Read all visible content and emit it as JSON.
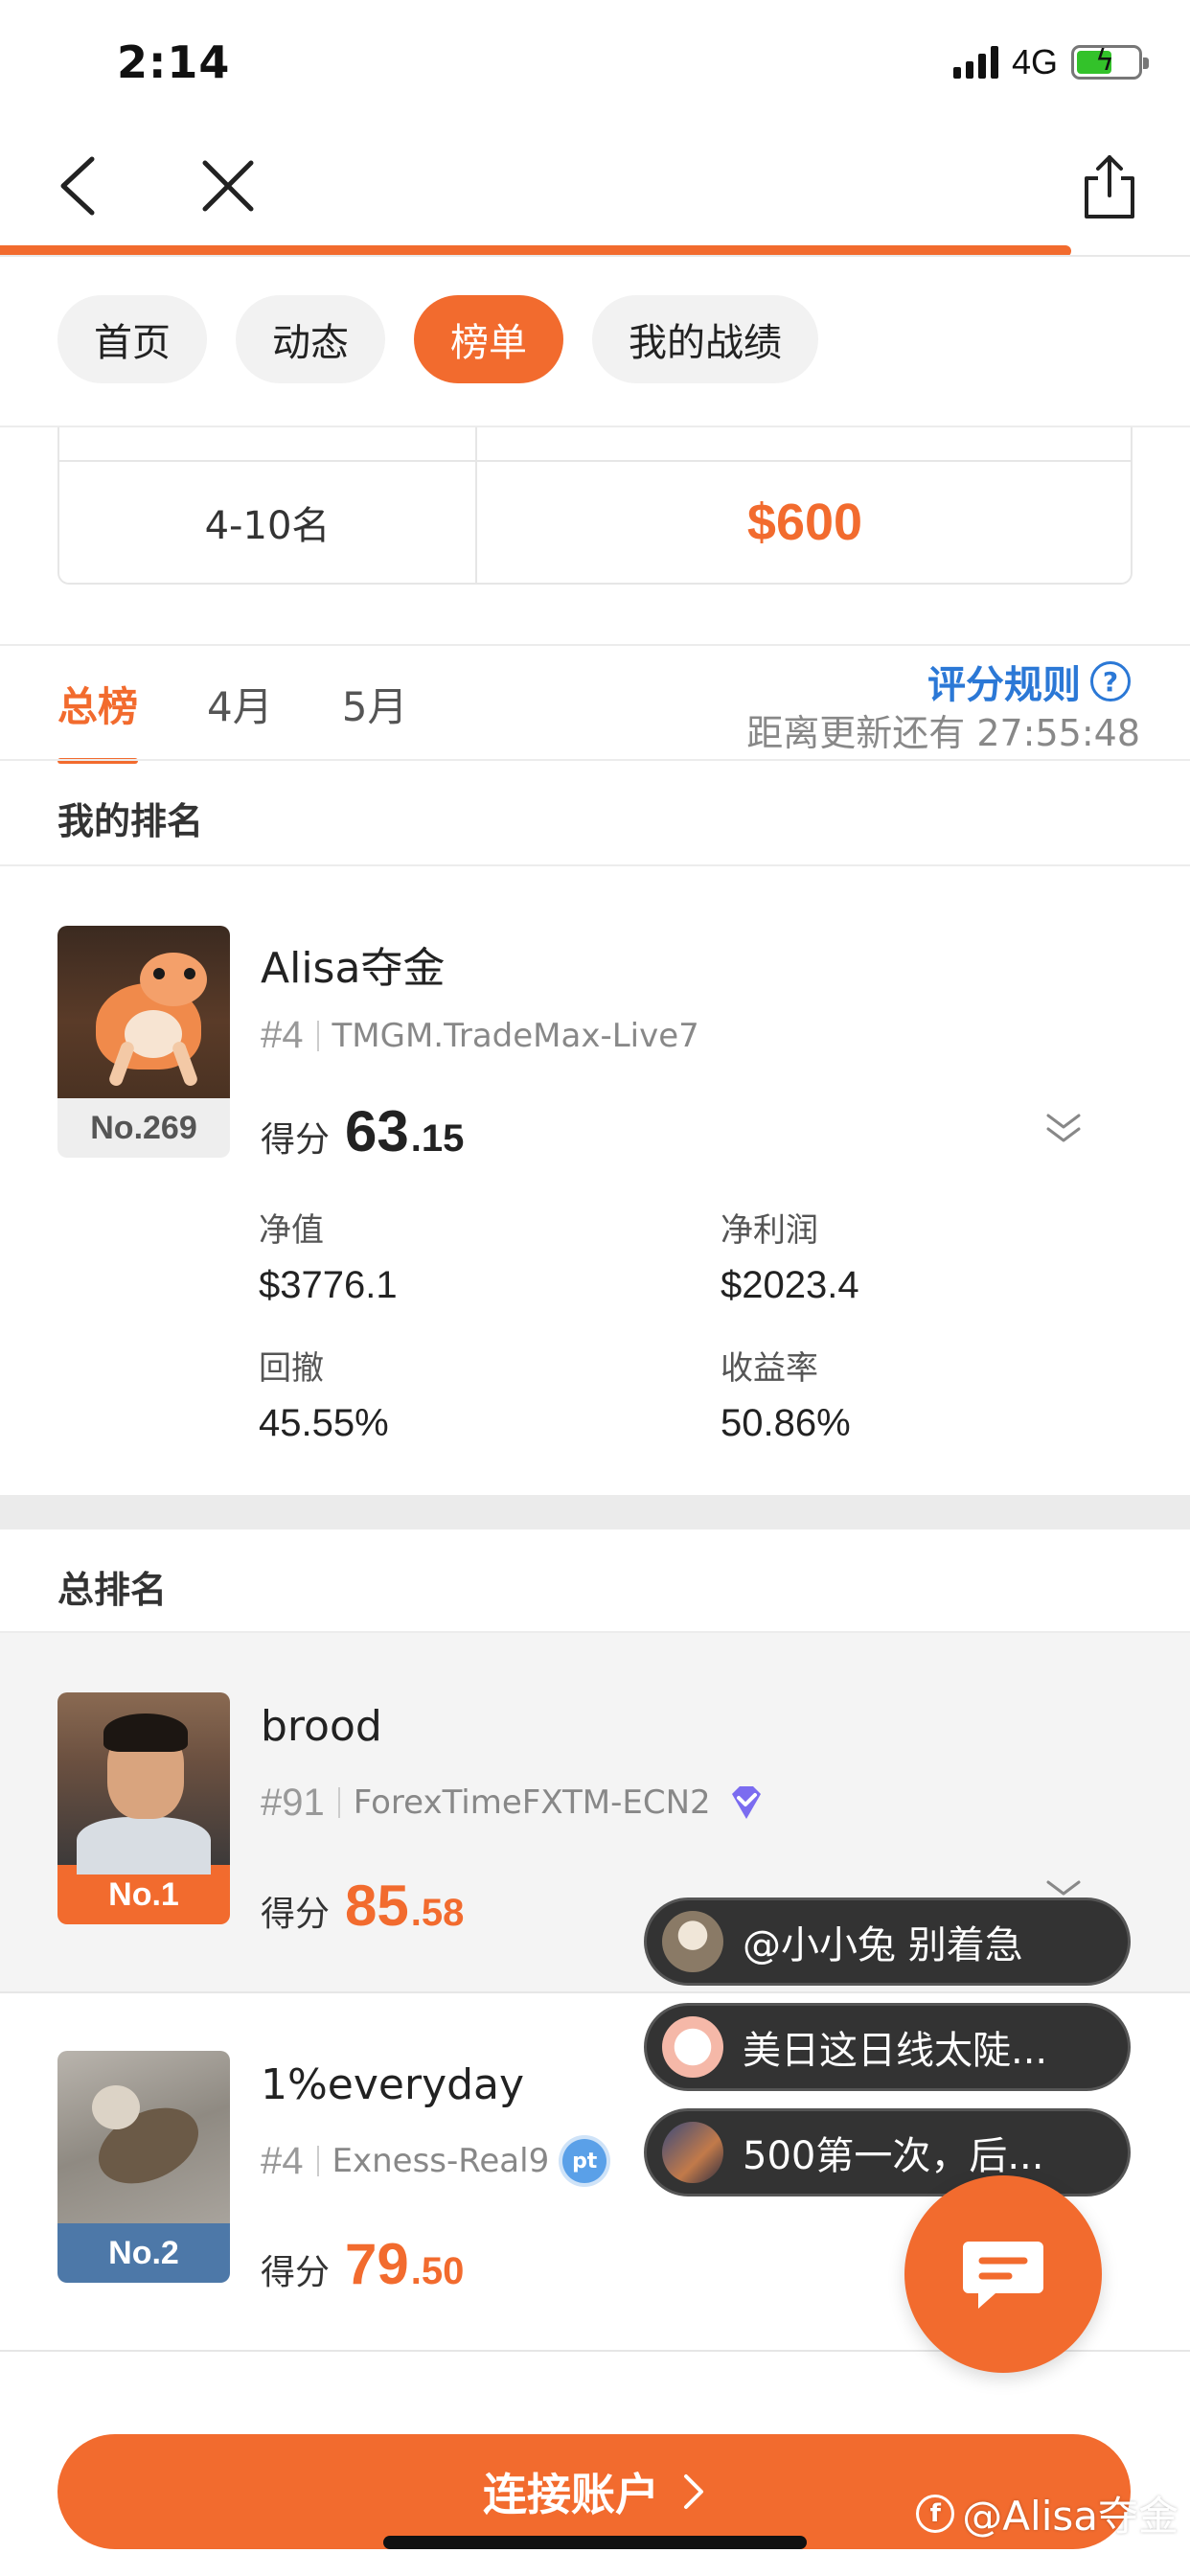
{
  "status_bar": {
    "time": "2:14",
    "network": "4G"
  },
  "nav": {
    "progress_percent": 90
  },
  "pills": [
    {
      "label": "首页",
      "active": false
    },
    {
      "label": "动态",
      "active": false
    },
    {
      "label": "榜单",
      "active": true
    },
    {
      "label": "我的战绩",
      "active": false
    }
  ],
  "prize_table": {
    "rank": "4-10名",
    "amount": "$600"
  },
  "period_tabs": [
    {
      "label": "总榜",
      "active": true
    },
    {
      "label": "4月",
      "active": false
    },
    {
      "label": "5月",
      "active": false
    }
  ],
  "rules": {
    "label": "评分规则",
    "icon": "question-circle-icon"
  },
  "countdown": "距离更新还有 27:55:48",
  "my_ranking": {
    "title": "我的排名",
    "name": "Alisa夺金",
    "number": "#4",
    "server": "TMGM.TradeMax-Live7",
    "rank_tag": "No.269",
    "score_label": "得分",
    "score_int": "63",
    "score_dec": ".15",
    "metrics": [
      {
        "label": "净值",
        "value": "$3776.1"
      },
      {
        "label": "净利润",
        "value": "$2023.4"
      },
      {
        "label": "回撤",
        "value": "45.55%"
      },
      {
        "label": "收益率",
        "value": "50.86%"
      }
    ]
  },
  "total_ranking": {
    "title": "总排名",
    "rows": [
      {
        "name": "brood",
        "number": "#91",
        "server": "ForexTimeFXTM-ECN2",
        "rank_tag": "No.1",
        "score_label": "得分",
        "score_int": "85",
        "score_dec": ".58",
        "badge": "verified-diamond-icon"
      },
      {
        "name": "1%everyday",
        "number": "#4",
        "server": "Exness-Real9",
        "rank_tag": "No.2",
        "score_label": "得分",
        "score_int": "79",
        "score_dec": ".50",
        "badge": "pt",
        "badge_icon": "pt-badge-icon"
      }
    ]
  },
  "chat_bubbles": [
    {
      "text": "@小小兔 别着急"
    },
    {
      "text": "美日这日线太陡..."
    },
    {
      "text": "500第一次，后..."
    }
  ],
  "connect_button": {
    "label": "连接账户",
    "icon": "chevron-right-icon"
  },
  "watermark": {
    "logo": "f",
    "text": "@Alisa夺金"
  },
  "colors": {
    "accent": "#f26b2e",
    "link": "#2b78d6",
    "no2": "#4d78a8"
  }
}
